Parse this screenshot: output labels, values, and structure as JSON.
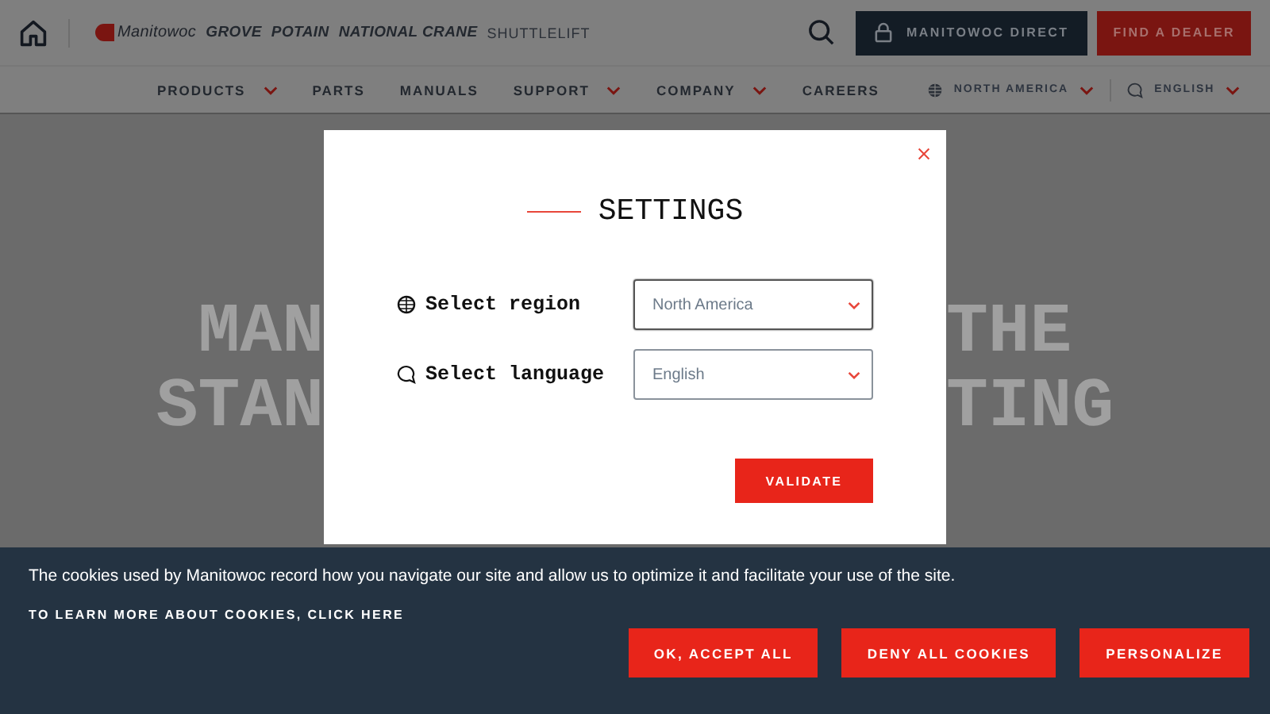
{
  "header": {
    "brands": [
      {
        "label": "Manitowoc",
        "kind": "badge"
      },
      {
        "label": "GROVE",
        "kind": "plain"
      },
      {
        "label": "POTAIN",
        "kind": "plain"
      },
      {
        "label": "NATIONAL CRANE",
        "kind": "plain"
      },
      {
        "label": "SHUTTLELIFT",
        "kind": "light"
      }
    ],
    "buttons": [
      {
        "label": "MANITOWOC DIRECT",
        "kind": "account"
      },
      {
        "label": "FIND A DEALER",
        "kind": "dealer"
      }
    ]
  },
  "nav": {
    "items": [
      {
        "label": "PRODUCTS",
        "dropdown": true
      },
      {
        "label": "PARTS",
        "dropdown": false
      },
      {
        "label": "MANUALS",
        "dropdown": false
      },
      {
        "label": "SUPPORT",
        "dropdown": true
      },
      {
        "label": "COMPANY",
        "dropdown": true
      },
      {
        "label": "CAREERS",
        "dropdown": false
      }
    ],
    "region": "NORTH AMERICA",
    "language": "ENGLISH"
  },
  "hero": {
    "left_lines": [
      "MAN",
      "STAN"
    ],
    "right_lines": [
      "THE",
      "TING"
    ]
  },
  "modal": {
    "title": "SETTINGS",
    "fields": [
      {
        "label": "Select region",
        "value": "North America",
        "kind": "region"
      },
      {
        "label": "Select language",
        "value": "English",
        "kind": "language"
      }
    ],
    "button": "VALIDATE"
  },
  "cookies": {
    "text": "The cookies used by Manitowoc record how you navigate our site and allow us to optimize it and facilitate your use of the site.",
    "link": "TO LEARN MORE ABOUT COOKIES, CLICK HERE",
    "buttons": [
      "OK, ACCEPT ALL",
      "DENY ALL COOKIES",
      "PERSONALIZE"
    ]
  }
}
